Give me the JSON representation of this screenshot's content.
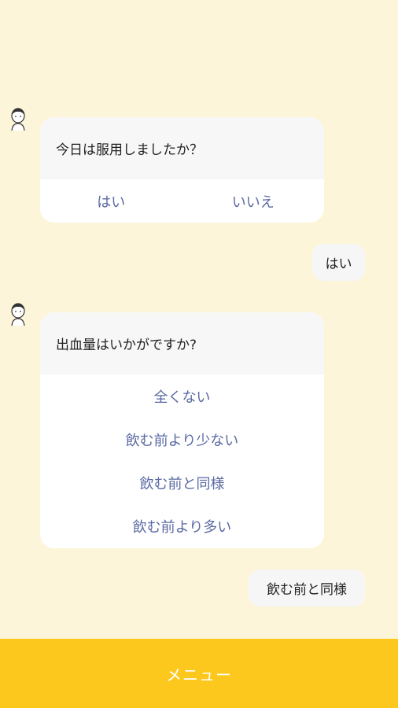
{
  "chat": {
    "q1": {
      "question": "今日は服用しましたか？",
      "options": [
        "はい",
        "いいえ"
      ]
    },
    "a1": "はい",
    "q2": {
      "question": "出血量はいかがですか?",
      "options": [
        "全くない",
        "飲む前より少ない",
        "飲む前と同様",
        "飲む前より多い"
      ]
    },
    "a2": "飲む前と同様"
  },
  "footer": {
    "menu_label": "メニュー"
  },
  "colors": {
    "background": "#fdf5d9",
    "option_text": "#5b6aa3",
    "menu_bar": "#fcc81e"
  },
  "icons": {
    "avatar": "doctor-avatar-icon"
  }
}
